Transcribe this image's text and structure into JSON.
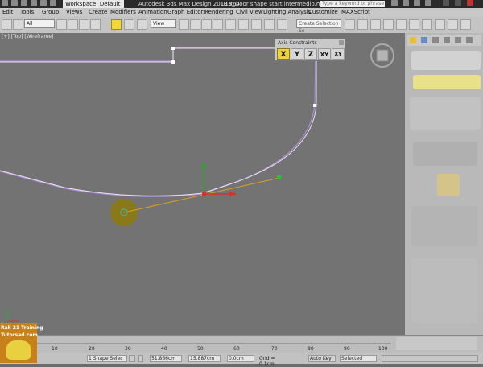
{
  "titlebar": {
    "workspace": "Workspace: Default",
    "app_title": "Autodesk 3ds Max Design 2013 x64",
    "file_name": "018_Door shape start intermedio.max",
    "help_search_placeholder": "Type a keyword or phrase"
  },
  "menu": [
    "Edit",
    "Tools",
    "Group",
    "Views",
    "Create",
    "Modifiers",
    "Animation",
    "Graph Editors",
    "Rendering",
    "Civil View",
    "Lighting Analysis",
    "Customize",
    "MAXScript"
  ],
  "toolbar": {
    "selection_filter": "All",
    "ref_coord": "View",
    "named_selection_placeholder": "Create Selection Se"
  },
  "viewport": {
    "label": "[+] [Top] [Wireframe]"
  },
  "axis_constraints": {
    "title": "Axis Constraints",
    "buttons": [
      "X",
      "Y",
      "Z",
      "XY",
      "XY"
    ],
    "active": "X"
  },
  "trackbar": {
    "ticks": [
      "10",
      "20",
      "30",
      "40",
      "50",
      "60",
      "70",
      "80",
      "90",
      "100"
    ]
  },
  "statusbar": {
    "shape_selected": "1 Shape Selec",
    "x_value": "51.866cm",
    "y_value": "15.887cm",
    "z_value": "0.0cm",
    "grid": "Grid = 0.1cm",
    "auto_key": "Auto Key",
    "key_filter": "Selected"
  },
  "logo": {
    "line1": "Rak 21 Training",
    "line2": "Tutorsad.com"
  },
  "colors": {
    "viewport_bg": "#737373",
    "spline": "#d8d8f0",
    "spline_shadow": "#b48ad4",
    "gizmo_x": "#e03020",
    "gizmo_y": "#20b020",
    "tangent": "#e0a020",
    "highlight_circle": "#8c7a10",
    "active_button": "#f0d23a"
  }
}
